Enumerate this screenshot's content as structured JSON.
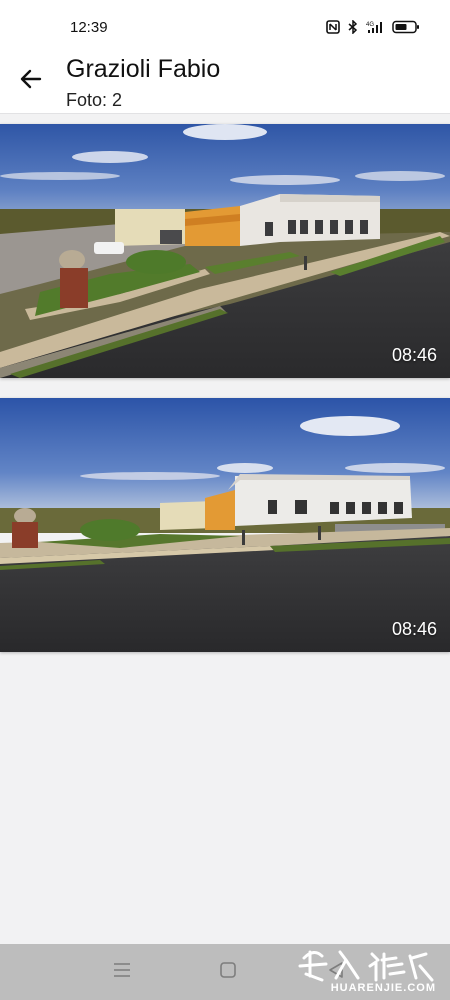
{
  "status_bar": {
    "time": "12:39",
    "icons": [
      "nfc-icon",
      "bluetooth-icon",
      "signal-4g-icon",
      "battery-icon"
    ]
  },
  "header": {
    "back_icon": "arrow-left-icon",
    "title": "Grazioli Fabio",
    "subtitle": "Foto: 2"
  },
  "photos": [
    {
      "time": "08:46"
    },
    {
      "time": "08:46"
    }
  ],
  "nav_bar": {
    "icons": [
      "menu-icon",
      "home-square-icon",
      "back-triangle-icon"
    ]
  },
  "watermark": {
    "text": "HUARENJIE.COM"
  }
}
